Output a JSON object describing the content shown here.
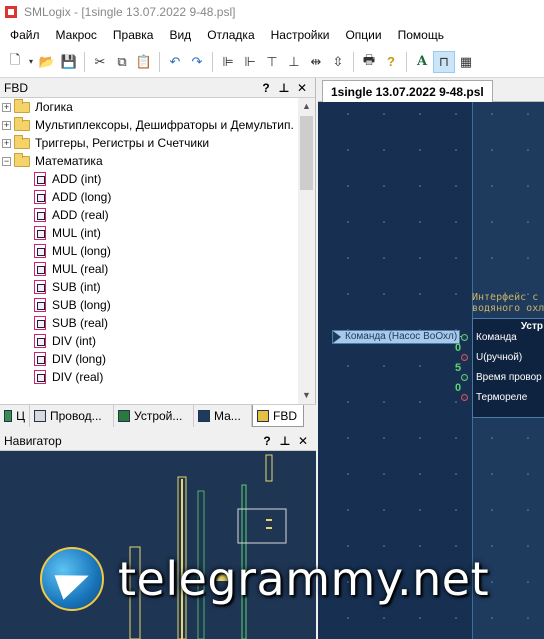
{
  "window": {
    "title": "SMLogix - [1single 13.07.2022 9-48.psl]"
  },
  "menu": [
    "Файл",
    "Макрос",
    "Правка",
    "Вид",
    "Отладка",
    "Настройки",
    "Опции",
    "Помощь"
  ],
  "fbd_panel": {
    "title": "FBD",
    "help": "?",
    "pin": "⊥",
    "close": "✕",
    "folders": [
      {
        "label": "Логика",
        "expander": "+"
      },
      {
        "label": "Мультиплексоры, Дешифраторы и Демультип.",
        "expander": "+"
      },
      {
        "label": "Триггеры, Регистры и Счетчики",
        "expander": "+"
      },
      {
        "label": "Математика",
        "expander": "−"
      }
    ],
    "items": [
      "ADD (int)",
      "ADD (long)",
      "ADD (real)",
      "MUL (int)",
      "MUL (long)",
      "MUL (real)",
      "SUB (int)",
      "SUB (long)",
      "SUB (real)",
      "DIV (int)",
      "DIV (long)",
      "DIV (real)"
    ],
    "tabs": [
      "Ц",
      "Провод...",
      "Устрой...",
      "Ма...",
      "FBD"
    ]
  },
  "navigator": {
    "title": "Навигатор",
    "help": "?",
    "pin": "⊥",
    "close": "✕"
  },
  "document": {
    "tab": "1single 13.07.2022 9-48.psl",
    "block_title_line1": "Интерфейс с",
    "block_title_line2": "водяного охл",
    "block_header": "Устр",
    "input_tag": "Команда (Насос ВоОхл)",
    "ports": [
      {
        "label": "Команда",
        "value": ""
      },
      {
        "label": "U(ручной)",
        "value": "0"
      },
      {
        "label": "Время провор",
        "value": "5"
      },
      {
        "label": "Термореле",
        "value": "0"
      }
    ]
  },
  "watermark": "telegrammy.net"
}
